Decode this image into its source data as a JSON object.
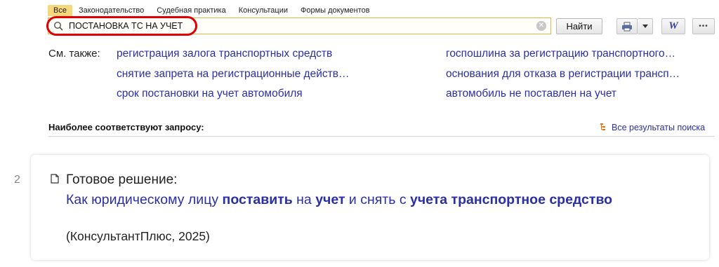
{
  "tabs": [
    {
      "label": "Все",
      "active": true
    },
    {
      "label": "Законодательство",
      "active": false
    },
    {
      "label": "Судебная практика",
      "active": false
    },
    {
      "label": "Консультации",
      "active": false
    },
    {
      "label": "Формы документов",
      "active": false
    }
  ],
  "search": {
    "query": "ПОСТАНОВКА ТС НА УЧЕТ",
    "find_label": "Найти"
  },
  "toolbar": {
    "icons": [
      "printer-icon",
      "chevron-down-icon",
      "word-icon",
      "more-icon"
    ],
    "word_letter": "W",
    "more_glyph": "•••"
  },
  "see_also": {
    "label": "См. также:",
    "links": [
      "регистрация залога транспортных средств",
      "госпошлина за регистрацию транспортного…",
      "снятие запрета на регистрационные действ…",
      "основания для отказа в регистрации трансп…",
      "срок постановки на учет автомобиля",
      "автомобиль не поставлен на учет"
    ]
  },
  "results": {
    "heading": "Наиболее соответствуют запросу:",
    "all_results_label": "Все результаты поиска",
    "item": {
      "number": "2",
      "type": "Готовое решение:",
      "title_parts": [
        {
          "text": "Как юридическому лицу ",
          "bold": false
        },
        {
          "text": "поставить",
          "bold": true
        },
        {
          "text": " на ",
          "bold": false
        },
        {
          "text": "учет",
          "bold": true
        },
        {
          "text": " и снять с ",
          "bold": false
        },
        {
          "text": "учета транспортное средство",
          "bold": true
        }
      ],
      "source": "(КонсультантПлюс, 2025)"
    }
  },
  "colors": {
    "accent": "#f6d77b",
    "link": "#2a2fa8",
    "highlight_ring": "#e00000"
  }
}
